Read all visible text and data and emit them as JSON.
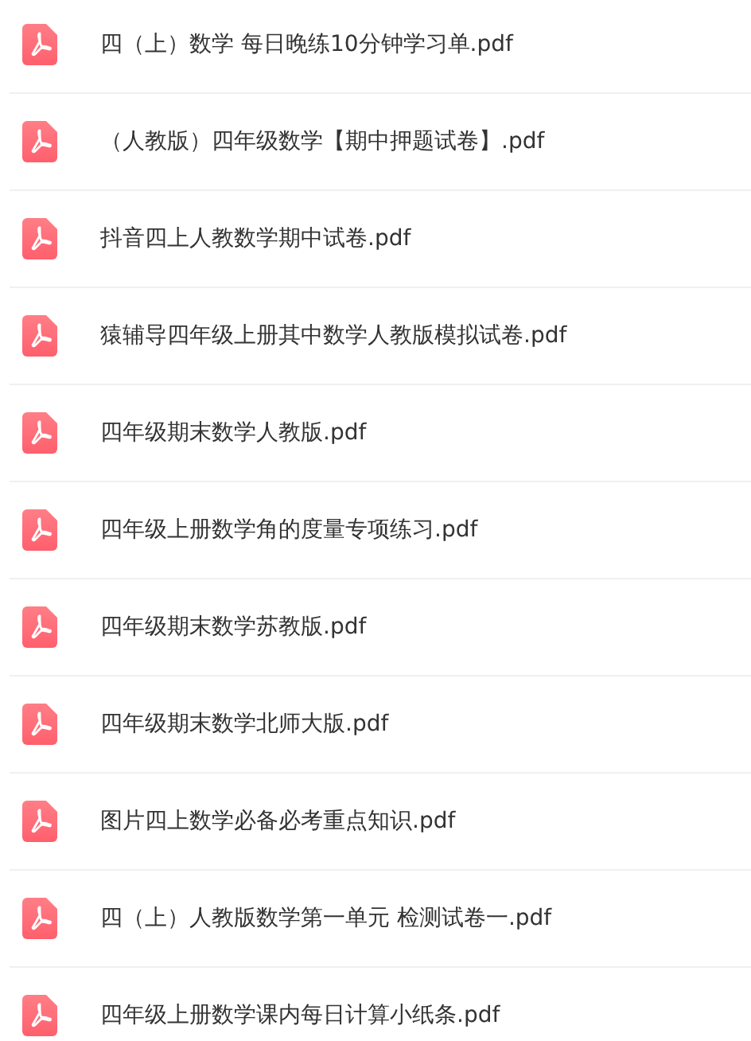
{
  "files": [
    {
      "name": "四（上）数学 每日晚练10分钟学习单.pdf"
    },
    {
      "name": "（人教版）四年级数学【期中押题试卷】.pdf"
    },
    {
      "name": "抖音四上人教数学期中试卷.pdf"
    },
    {
      "name": "猿辅导四年级上册其中数学人教版模拟试卷.pdf"
    },
    {
      "name": "四年级期末数学人教版.pdf"
    },
    {
      "name": "四年级上册数学角的度量专项练习.pdf"
    },
    {
      "name": "四年级期末数学苏教版.pdf"
    },
    {
      "name": "四年级期末数学北师大版.pdf"
    },
    {
      "name": "图片四上数学必备必考重点知识.pdf"
    },
    {
      "name": "四（上）人教版数学第一单元 检测试卷一.pdf"
    },
    {
      "name": "四年级上册数学课内每日计算小纸条.pdf"
    }
  ]
}
